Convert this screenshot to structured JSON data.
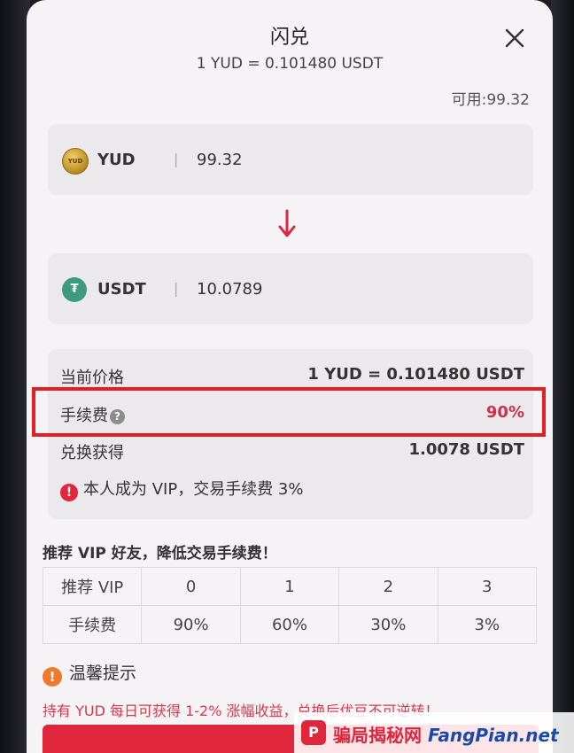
{
  "header": {
    "title": "闪兑",
    "rate_line": "1 YUD = 0.101480 USDT"
  },
  "available": "可用:99.32",
  "from_asset": {
    "icon": "yud-coin-icon",
    "coin_text": "YUD",
    "name": "YUD",
    "separator": "|",
    "amount": "99.32"
  },
  "to_asset": {
    "icon": "usdt-coin-icon",
    "coin_text": "₮",
    "name": "USDT",
    "separator": "|",
    "amount": "10.0789"
  },
  "details": {
    "price_label": "当前价格",
    "price_value": "1 YUD = 0.101480 USDT",
    "fee_label": "手续费",
    "fee_help": "?",
    "fee_value": "90%",
    "receive_label": "兑换获得",
    "receive_value": "1.0078 USDT",
    "vip_alert_icon": "!",
    "vip_note": "本人成为 VIP，交易手续费 3%"
  },
  "promo": {
    "title": "推荐 VIP 好友，降低交易手续费！",
    "row_headers": [
      "推荐 VIP",
      "手续费"
    ],
    "levels": [
      "0",
      "1",
      "2",
      "3"
    ],
    "fees": [
      "90%",
      "60%",
      "30%",
      "3%"
    ]
  },
  "tips": {
    "icon": "!",
    "title": "温馨提示",
    "text": "持有 YUD 每日可获得 1-2% 涨幅收益，兑换后优豆不可逆转！"
  },
  "watermark": {
    "logo": "P",
    "cn": "骗局揭秘网",
    "en": "FangPian.net"
  },
  "colors": {
    "accent_red": "#e0263c",
    "fee_red": "#c8344a",
    "usdt_green": "#3e9a7d",
    "highlight_frame": "#e41e25"
  }
}
